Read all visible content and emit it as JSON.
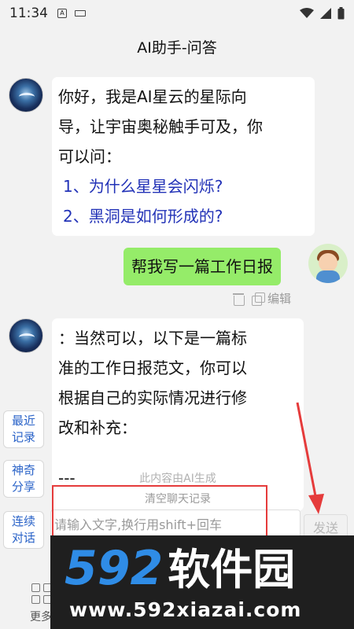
{
  "status_bar": {
    "time": "11:34",
    "notification_glyph": "A"
  },
  "header": {
    "title": "AI助手-问答"
  },
  "messages": {
    "bot_greeting": {
      "lines": [
        "你好，我是AI星云的星际向",
        "导，让宇宙奥秘触手可及，你",
        "可以问："
      ],
      "suggestions": [
        "1、为什么星星会闪烁?",
        "2、黑洞是如何形成的?"
      ]
    },
    "user_message": {
      "text": "帮我写一篇工作日报",
      "edit_label": "编辑"
    },
    "bot_reply": {
      "lines": [
        "：当然可以，以下是一篇标",
        "准的工作日报范文，你可以",
        "根据自己的实际情况进行修",
        "改和补充："
      ],
      "trailing": "---"
    }
  },
  "side_buttons": [
    "最近\n记录",
    "神奇\n分享",
    "连续\n对话"
  ],
  "ai_note": "此内容由AI生成",
  "clear_record": "清空聊天记录",
  "input": {
    "placeholder": "请输入文字,换行用shift+回车",
    "send_label": "发送"
  },
  "more_label": "更多",
  "watermark": {
    "brand_digits": "592",
    "brand_cn": "软件园",
    "url": "www.592xiazai.com"
  },
  "colors": {
    "user_bubble": "#95ec69",
    "suggestion_text": "#2232b7",
    "side_button_text": "#2a63c8",
    "annotation_red": "#e53b3b"
  }
}
